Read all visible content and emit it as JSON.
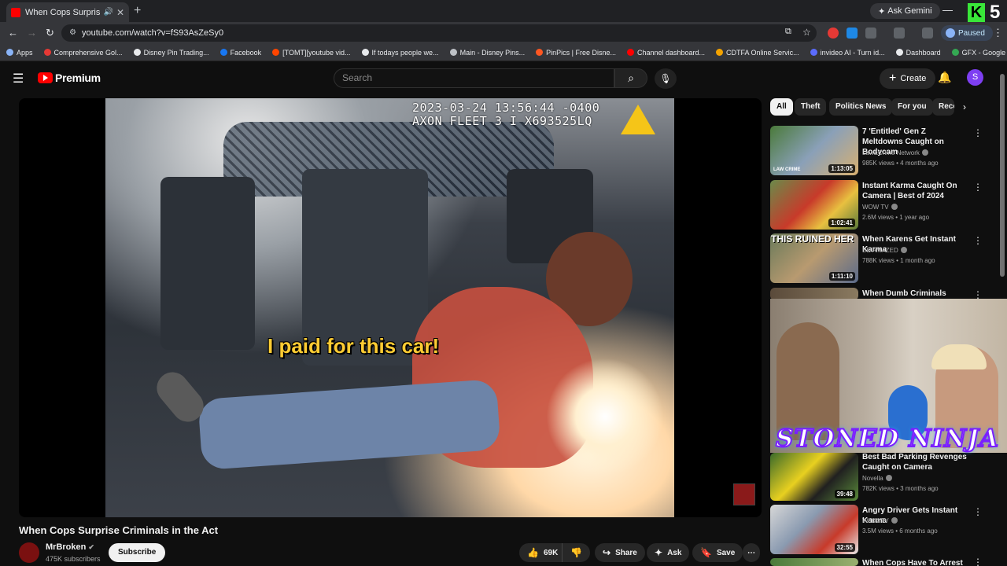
{
  "browser": {
    "tab_title": "When Cops Surprise Crimin",
    "ask_gemini": "Ask Gemini",
    "url": "youtube.com/watch?v=fS93AsZeSy0",
    "profile_status": "Paused",
    "bookmarks": [
      {
        "label": "Apps",
        "color": "#8ab4f8"
      },
      {
        "label": "Comprehensive Gol...",
        "color": "#e53935"
      },
      {
        "label": "Disney Pin Trading...",
        "color": "#e8eaed"
      },
      {
        "label": "Facebook",
        "color": "#1877f2"
      },
      {
        "label": "[TOMT][youtube vid...",
        "color": "#ff4500"
      },
      {
        "label": "If todays people we...",
        "color": "#e8eaed"
      },
      {
        "label": "Main - Disney Pins...",
        "color": "#bdc1c6"
      },
      {
        "label": "PinPics | Free Disne...",
        "color": "#ff5722"
      },
      {
        "label": "Channel dashboard...",
        "color": "#ff0000"
      },
      {
        "label": "CDTFA Online Servic...",
        "color": "#f4a300"
      },
      {
        "label": "invideo AI - Turn id...",
        "color": "#5b6cff"
      },
      {
        "label": "Dashboard",
        "color": "#e8eaed"
      },
      {
        "label": "GFX - Google Drive",
        "color": "#34a853"
      }
    ]
  },
  "header": {
    "logo_text": "Premium",
    "search_placeholder": "Search",
    "create_label": "Create",
    "avatar_letter": "S"
  },
  "video": {
    "timestamp_line1": "2023-03-24 13:56:44 -0400",
    "timestamp_line2": "AXON FLEET 3 I X693525LQ",
    "caption": "I paid for this car!",
    "title": "When Cops Surprise Criminals in the Act",
    "channel": "MrBroken",
    "subscribers": "475K subscribers",
    "subscribe_label": "Subscribe",
    "likes": "69K",
    "share_label": "Share",
    "ask_label": "Ask",
    "save_label": "Save"
  },
  "chips": [
    "All",
    "Theft",
    "Politics News",
    "For you",
    "Rece"
  ],
  "recommendations": [
    {
      "title": "7 'Entitled' Gen Z Meltdowns Caught on Bodycam",
      "channel": "Law&Crime Network",
      "meta": "985K views • 4 months ago",
      "duration": "1:13:05",
      "thumb_overlay": "LAW CRIME"
    },
    {
      "title": "Instant Karma Caught On Camera | Best of 2024",
      "channel": "WOW TV",
      "meta": "2.6M views • 1 year ago",
      "duration": "1:02:41"
    },
    {
      "title": "When Karens Get Instant Karma",
      "channel": "BE AMAZED",
      "meta": "788K views • 1 month ago",
      "duration": "1:11:10",
      "thumb_overlay": "THIS RUINED HER"
    },
    {
      "title": "When Dumb Criminals Realize",
      "channel": "",
      "meta": "",
      "duration": ""
    },
    {
      "title": "Best Bad Parking Revenges Caught on Camera",
      "channel": "Novella",
      "meta": "782K views • 3 months ago",
      "duration": "39:48"
    },
    {
      "title": "Angry Driver Gets Instant Karma",
      "channel": "WOW TV",
      "meta": "3.5M views • 6 months ago",
      "duration": "32:55"
    },
    {
      "title": "When Cops Have To Arrest",
      "channel": "",
      "meta": "",
      "duration": ""
    }
  ],
  "overlay": {
    "streamer_text": "STONED NINJA"
  },
  "colors": {
    "brand_red": "#ff0000",
    "accent_purple": "#7e3ff2",
    "caption_yellow": "#ffcc33",
    "ninja_outline": "#7a1fff"
  }
}
